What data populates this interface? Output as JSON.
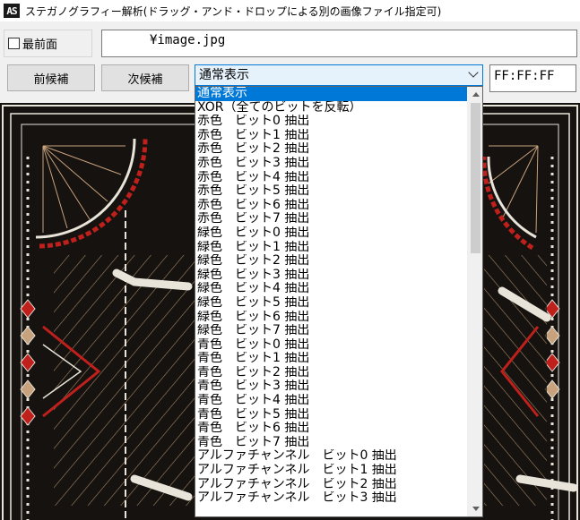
{
  "window": {
    "icon_text": "AS",
    "title": "ステガノグラフィー解析(ドラッグ・アンド・ドロップによる別の画像ファイル指定可)"
  },
  "options": {
    "topmost_label": "最前面",
    "topmost_checked": false
  },
  "file": {
    "path": "¥image.jpg"
  },
  "nav": {
    "prev_label": "前候補",
    "next_label": "次候補"
  },
  "mode_select": {
    "value": "通常表示",
    "options": [
      "通常表示",
      "XOR（全てのビットを反転）",
      "赤色　ビット0 抽出",
      "赤色　ビット1 抽出",
      "赤色　ビット2 抽出",
      "赤色　ビット3 抽出",
      "赤色　ビット4 抽出",
      "赤色　ビット5 抽出",
      "赤色　ビット6 抽出",
      "赤色　ビット7 抽出",
      "緑色　ビット0 抽出",
      "緑色　ビット1 抽出",
      "緑色　ビット2 抽出",
      "緑色　ビット3 抽出",
      "緑色　ビット4 抽出",
      "緑色　ビット5 抽出",
      "緑色　ビット6 抽出",
      "緑色　ビット7 抽出",
      "青色　ビット0 抽出",
      "青色　ビット1 抽出",
      "青色　ビット2 抽出",
      "青色　ビット3 抽出",
      "青色　ビット4 抽出",
      "青色　ビット5 抽出",
      "青色　ビット6 抽出",
      "青色　ビット7 抽出",
      "アルファチャンネル　ビット0 抽出",
      "アルファチャンネル　ビット1 抽出",
      "アルファチャンネル　ビット2 抽出",
      "アルファチャンネル　ビット3 抽出"
    ],
    "selected_index": 0
  },
  "pixel_color": {
    "value": "FF:FF:FF"
  },
  "colors": {
    "accent": "#0078d7",
    "image_bg": "#15120f",
    "image_line": "#e8e4da",
    "image_gold": "#c8a27c",
    "image_red": "#c0201c"
  }
}
